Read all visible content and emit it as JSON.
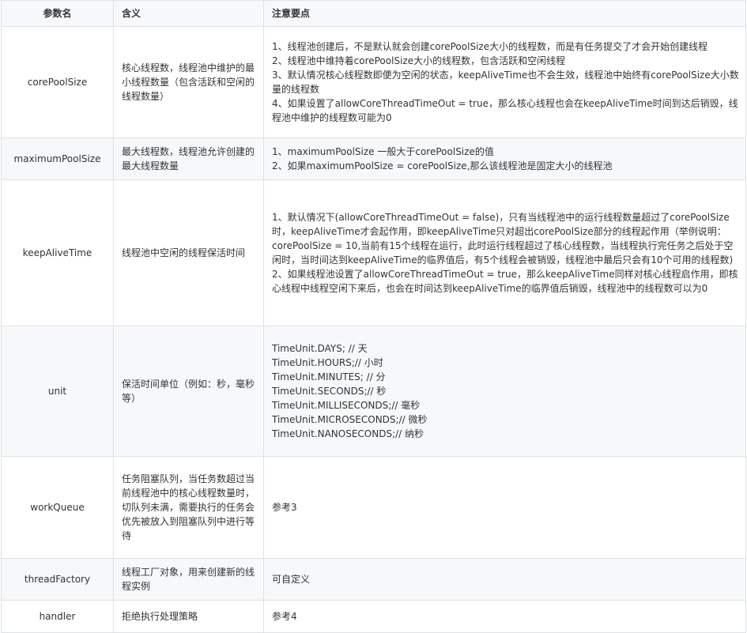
{
  "table": {
    "headers": [
      "参数名",
      "含义",
      "注意要点"
    ],
    "rows": [
      {
        "name": "corePoolSize",
        "meaning": "核心线程数，线程池中维护的最小线程数量（包含活跃和空闲的线程数量）",
        "notes": [
          "1、线程池创建后，不是默认就会创建corePoolSize大小的线程数，而是有任务提交了才会开始创建线程",
          "2、线程池中维持着corePoolSize大小的线程数，包含活跃和空闲线程",
          "3、默认情况核心线程数即便为空闲的状态，keepAliveTime也不会生效，线程池中始终有corePoolSize大小数量的线程数",
          "4、如果设置了allowCoreThreadTimeOut = true，那么核心线程也会在keepAliveTime时间到达后销毁，线程池中维护的线程数可能为0"
        ]
      },
      {
        "name": "maximumPoolSize",
        "meaning": "最大线程数，线程池允许创建的最大线程数量",
        "notes": [
          "1、maximumPoolSize 一般大于corePoolSize的值",
          "2、如果maximumPoolSize = corePoolSize,那么该线程池是固定大小的线程池"
        ]
      },
      {
        "name": "keepAliveTime",
        "meaning": "线程池中空闲的线程保活时间",
        "notes": [
          "1、默认情况下(allowCoreThreadTimeOut = false)，只有当线程池中的运行线程数量超过了corePoolSize时，keepAliveTime才会起作用，即keepAliveTime只对超出corePoolSize部分的线程起作用（举例说明：corePoolSize = 10,当前有15个线程在运行，此时运行线程超过了核心线程数，当线程执行完任务之后处于空闲时，当时间达到keepAliveTime的临界值后，有5个线程会被销毁，线程池中最后只会有10个可用的线程数)",
          "2、如果线程池设置了allowCoreThreadTimeOut = true，那么keepAliveTime同样对核心线程启作用，即核心线程中线程空闲下来后，也会在时间达到keepAliveTime的临界值后销毁，线程池中的线程数可以为0"
        ]
      },
      {
        "name": "unit",
        "meaning": "保活时间单位（例如：秒，毫秒等）",
        "notes": [
          "TimeUnit.DAYS; // 天",
          "TimeUnit.HOURS;// 小时",
          "TimeUnit.MINUTES; // 分",
          "TimeUnit.SECONDS;// 秒",
          "TimeUnit.MILLISECONDS;// 毫秒",
          "TimeUnit.MICROSECONDS;// 微秒",
          "TimeUnit.NANOSECONDS;// 纳秒"
        ]
      },
      {
        "name": "workQueue",
        "meaning": "任务阻塞队列，当任务数超过当前线程池中的核心线程数量时，切队列未满，需要执行的任务会优先被放入到阻塞队列中进行等待",
        "notes": [
          "参考3"
        ]
      },
      {
        "name": "threadFactory",
        "meaning": "线程工厂对象，用来创建新的线程实例",
        "notes": [
          "可自定义"
        ]
      },
      {
        "name": "handler",
        "meaning": "拒绝执行处理策略",
        "notes": [
          "参考4"
        ]
      }
    ]
  }
}
